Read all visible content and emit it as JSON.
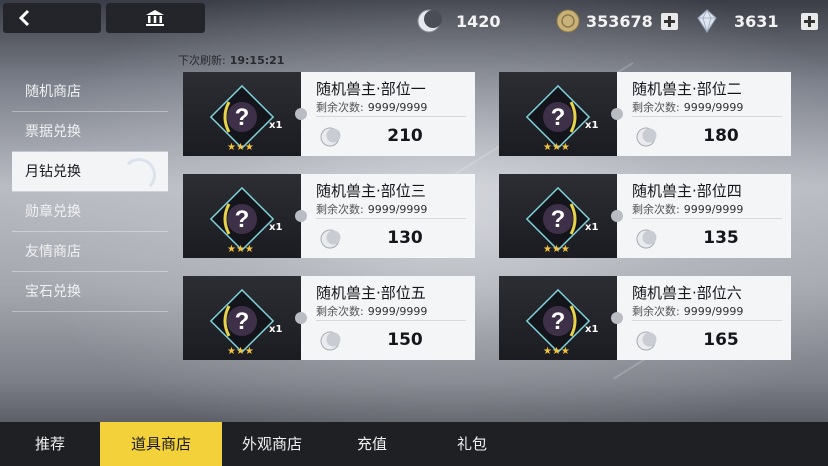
{
  "colors": {
    "accent": "#f2d13a",
    "dark": "#23252b",
    "card": "#f4f5f7",
    "star": "#f2c43d"
  },
  "currencies": [
    {
      "name": "moon-icon",
      "value": "1420",
      "has_plus": false
    },
    {
      "name": "coin-icon",
      "value": "353678",
      "has_plus": true
    },
    {
      "name": "crystal-icon",
      "value": "3631",
      "has_plus": true
    }
  ],
  "sidebar": {
    "items": [
      {
        "label": "随机商店",
        "active": false
      },
      {
        "label": "票据兑换",
        "active": false
      },
      {
        "label": "月钻兑换",
        "active": true
      },
      {
        "label": "勋章兑换",
        "active": false
      },
      {
        "label": "友情商店",
        "active": false
      },
      {
        "label": "宝石兑换",
        "active": false
      }
    ]
  },
  "refresh": {
    "label": "下次刷新:",
    "time": "19:15:21"
  },
  "items": [
    {
      "title": "随机兽主·部位一",
      "remain_label": "剩余次数:",
      "remain": "9999/9999",
      "price": "210",
      "qty": "x1",
      "stars": "★★★"
    },
    {
      "title": "随机兽主·部位二",
      "remain_label": "剩余次数:",
      "remain": "9999/9999",
      "price": "180",
      "qty": "x1",
      "stars": "★★★"
    },
    {
      "title": "随机兽主·部位三",
      "remain_label": "剩余次数:",
      "remain": "9999/9999",
      "price": "130",
      "qty": "x1",
      "stars": "★★★"
    },
    {
      "title": "随机兽主·部位四",
      "remain_label": "剩余次数:",
      "remain": "9999/9999",
      "price": "135",
      "qty": "x1",
      "stars": "★★★"
    },
    {
      "title": "随机兽主·部位五",
      "remain_label": "剩余次数:",
      "remain": "9999/9999",
      "price": "150",
      "qty": "x1",
      "stars": "★★★"
    },
    {
      "title": "随机兽主·部位六",
      "remain_label": "剩余次数:",
      "remain": "9999/9999",
      "price": "165",
      "qty": "x1",
      "stars": "★★★"
    }
  ],
  "bottom_tabs": [
    {
      "label": "推荐",
      "active": false
    },
    {
      "label": "道具商店",
      "active": true
    },
    {
      "label": "外观商店",
      "active": false
    },
    {
      "label": "充值",
      "active": false
    },
    {
      "label": "礼包",
      "active": false
    }
  ]
}
